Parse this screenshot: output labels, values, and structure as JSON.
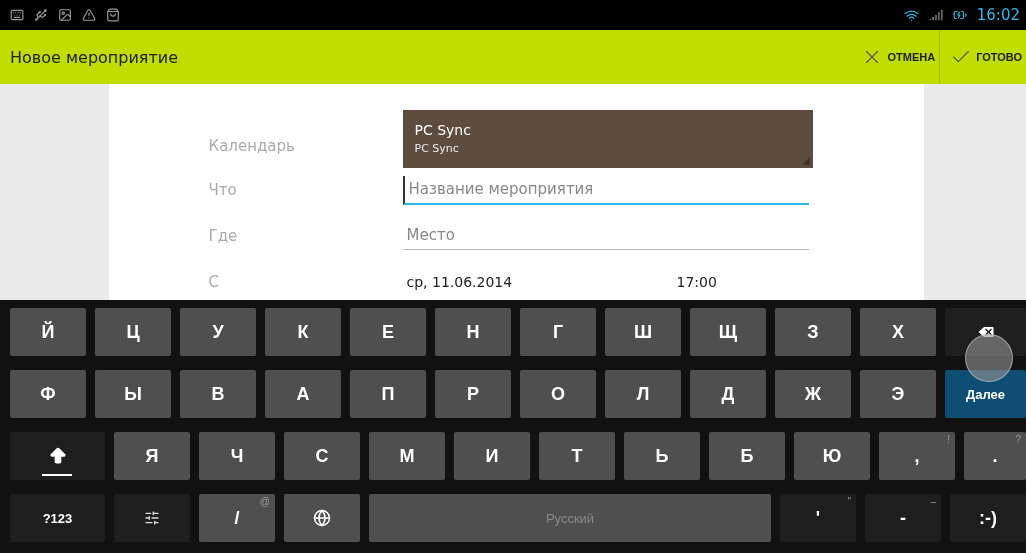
{
  "status_bar": {
    "time": "16:02"
  },
  "action_bar": {
    "title": "Новое мероприятие",
    "actions": [
      {
        "kind": "cancel",
        "label": "ОТМЕНА"
      },
      {
        "kind": "done",
        "label": "ГОТОВО"
      }
    ]
  },
  "form": {
    "calendar": {
      "label": "Календарь",
      "name": "PC Sync",
      "account": "PC Sync"
    },
    "fields": [
      {
        "label": "Что",
        "placeholder": "Название мероприятия",
        "focused": true
      },
      {
        "label": "Где",
        "placeholder": "Место",
        "focused": false
      }
    ],
    "start": {
      "label": "С",
      "date": "ср, 11.06.2014",
      "time": "17:00"
    }
  },
  "keyboard": {
    "rows": [
      {
        "keys": [
          {
            "kind": "letter",
            "label": "Й"
          },
          {
            "kind": "letter",
            "label": "Ц"
          },
          {
            "kind": "letter",
            "label": "У"
          },
          {
            "kind": "letter",
            "label": "К"
          },
          {
            "kind": "letter",
            "label": "Е"
          },
          {
            "kind": "letter",
            "label": "Н"
          },
          {
            "kind": "letter",
            "label": "Г"
          },
          {
            "kind": "letter",
            "label": "Ш"
          },
          {
            "kind": "letter",
            "label": "Щ"
          },
          {
            "kind": "letter",
            "label": "З"
          },
          {
            "kind": "letter",
            "label": "Х"
          },
          {
            "kind": "backspace"
          }
        ]
      },
      {
        "keys": [
          {
            "kind": "letter",
            "label": "Ф"
          },
          {
            "kind": "letter",
            "label": "Ы"
          },
          {
            "kind": "letter",
            "label": "В"
          },
          {
            "kind": "letter",
            "label": "А"
          },
          {
            "kind": "letter",
            "label": "П"
          },
          {
            "kind": "letter",
            "label": "Р"
          },
          {
            "kind": "letter",
            "label": "О"
          },
          {
            "kind": "letter",
            "label": "Л"
          },
          {
            "kind": "letter",
            "label": "Д"
          },
          {
            "kind": "letter",
            "label": "Ж"
          },
          {
            "kind": "letter",
            "label": "Э"
          },
          {
            "kind": "action",
            "label": "Далее"
          }
        ]
      },
      {
        "keys": [
          {
            "kind": "shift"
          },
          {
            "kind": "letter",
            "label": "Я"
          },
          {
            "kind": "letter",
            "label": "Ч"
          },
          {
            "kind": "letter",
            "label": "С"
          },
          {
            "kind": "letter",
            "label": "М"
          },
          {
            "kind": "letter",
            "label": "И"
          },
          {
            "kind": "letter",
            "label": "Т"
          },
          {
            "kind": "letter",
            "label": "Ь"
          },
          {
            "kind": "letter",
            "label": "Б"
          },
          {
            "kind": "letter",
            "label": "Ю"
          },
          {
            "kind": "letter",
            "label": ",",
            "hint": "!"
          },
          {
            "kind": "letter",
            "label": ".",
            "hint": "?"
          }
        ]
      },
      {
        "keys": [
          {
            "kind": "mode",
            "label": "?123"
          },
          {
            "kind": "settings"
          },
          {
            "kind": "letter",
            "label": "/",
            "hint": "@"
          },
          {
            "kind": "globe"
          },
          {
            "kind": "space",
            "label": "Русский"
          },
          {
            "kind": "function",
            "label": "'",
            "hint": "\""
          },
          {
            "kind": "function",
            "label": "-",
            "hint": "–"
          },
          {
            "kind": "function",
            "label": ":-)"
          }
        ]
      }
    ]
  }
}
